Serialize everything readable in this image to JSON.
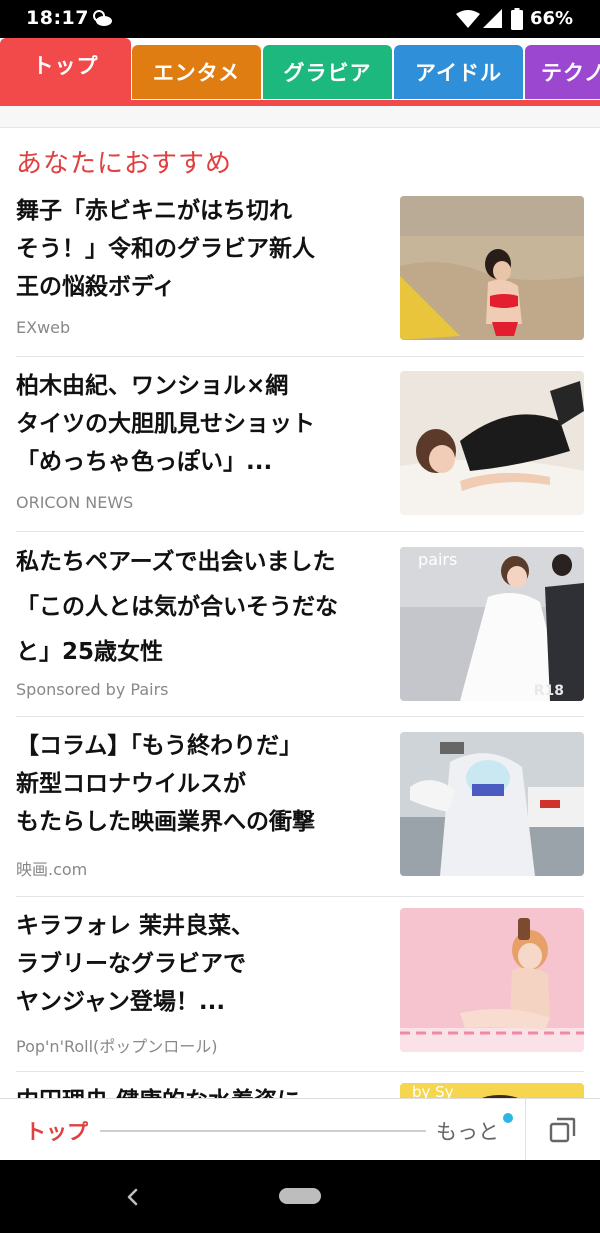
{
  "status_bar": {
    "time": "18:17",
    "battery_text": "66%",
    "icons": [
      "weather-icon",
      "wifi-icon",
      "signal-icon",
      "battery-icon"
    ]
  },
  "tabs": [
    {
      "label": "トップ",
      "color": "#f24a4a",
      "active": true
    },
    {
      "label": "エンタメ",
      "color": "#e07d12",
      "active": false
    },
    {
      "label": "グラビア",
      "color": "#1cb87e",
      "active": false
    },
    {
      "label": "アイドル",
      "color": "#2f8fd8",
      "active": false
    },
    {
      "label": "テクノ",
      "color": "#9b47d0",
      "active": false
    }
  ],
  "feed": {
    "section_title": "あなたにおすすめ",
    "articles": [
      {
        "headline_lines": [
          "舞子「赤ビキニがはち切れ",
          "そう！」令和のグラビア新人",
          "王の悩殺ボディ"
        ],
        "source": "EXweb"
      },
      {
        "headline_lines": [
          "柏木由紀、ワンショル×網",
          "タイツの大胆肌見せショット",
          "「めっちゃ色っぽい」..."
        ],
        "source": "ORICON NEWS"
      },
      {
        "headline_lines": [
          "私たちペアーズで出会いました",
          "「この人とは気が合いそうだな",
          "と」25歳女性"
        ],
        "source": "Sponsored by Pairs",
        "thumb_overlay": "pairs",
        "thumb_badge": "R18"
      },
      {
        "headline_lines": [
          "【コラム】「もう終わりだ」",
          "新型コロナウイルスが",
          "もたらした映画業界への衝撃"
        ],
        "source": "映画.com"
      },
      {
        "headline_lines": [
          "キラフォレ 茉井良菜、",
          "ラブリーなグラビアで",
          "ヤンジャン登場！..."
        ],
        "source": "Pop'n'Roll(ポップンロール)"
      },
      {
        "headline_lines": [
          "内田理央 健康的な水着姿に"
        ],
        "source": "",
        "thumb_overlay": "by Sy"
      }
    ]
  },
  "bottom_bar": {
    "top_label": "トップ",
    "more_label": "もっと",
    "accent": "#e0403f",
    "notification_dot_color": "#2eb5e6"
  }
}
